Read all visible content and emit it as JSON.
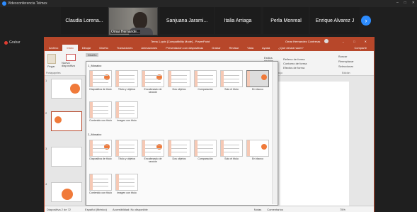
{
  "zoom_window": {
    "title": "Videoconferencia Telmex",
    "participants": [
      "Claudia Lorena...",
      "Sanjuana Jarami...",
      "Italia Arriaga",
      "Perla Monreal",
      "Enrique Alvarez J"
    ],
    "camera_name": "Omar Hernande...",
    "record_label": "Grabar",
    "next_icon": "chevron-right-icon",
    "accent": "#2d8cff"
  },
  "ppt": {
    "title": "Tema 1.pptx [Compatibility Mode] - PowerPoint",
    "user": "Omar Hernandez Contreras",
    "menu": [
      "Archivo",
      "Inicio",
      "Dibujar",
      "Diseño",
      "Transiciones",
      "Animaciones",
      "Presentación con diapositivas",
      "Grabar",
      "Revisar",
      "Vista",
      "Ayuda",
      "¿Qué desea hacer?"
    ],
    "share": "Compartir",
    "ribbon": {
      "paste": "Pegar",
      "new_slide": "Nueva diapositiva",
      "layout_btn": "Diseño",
      "clipboard": "Portapapeles",
      "drawing": "Dibujo",
      "styles": "Estilos rápidos",
      "fill": "Relleno de forma",
      "outline": "Contorno de forma",
      "effects": "Efectos de forma",
      "find": "Buscar",
      "replace": "Reemplazar",
      "select": "Seleccionar",
      "edit": "Edición"
    },
    "gallery": {
      "section1": "1_Mosaico",
      "section2": "2_Mosaico",
      "layouts1": [
        "Diapositiva de título",
        "Título y objetos",
        "Encabezado de sección",
        "Dos objetos",
        "Comparación",
        "Solo el título",
        "En blanco",
        "Contenido con título",
        "Imagen con título"
      ],
      "layouts2": [
        "Diapositiva de título",
        "Título y objetos",
        "Encabezado de sección",
        "Dos objetos",
        "Comparación",
        "Solo el título",
        "En blanco",
        "Contenido con título",
        "Imagen con título"
      ]
    },
    "thumbs": [
      "1",
      "2",
      "3",
      "4"
    ],
    "status": {
      "slide": "Diapositiva 2 de 72",
      "lang": "Español (México)",
      "access": "Accesibilidad: No disponible",
      "notes": "Notas",
      "comments": "Comentarios",
      "zoom": "75%"
    },
    "brand_color": "#b7472a",
    "orange": "#f07a3a"
  }
}
